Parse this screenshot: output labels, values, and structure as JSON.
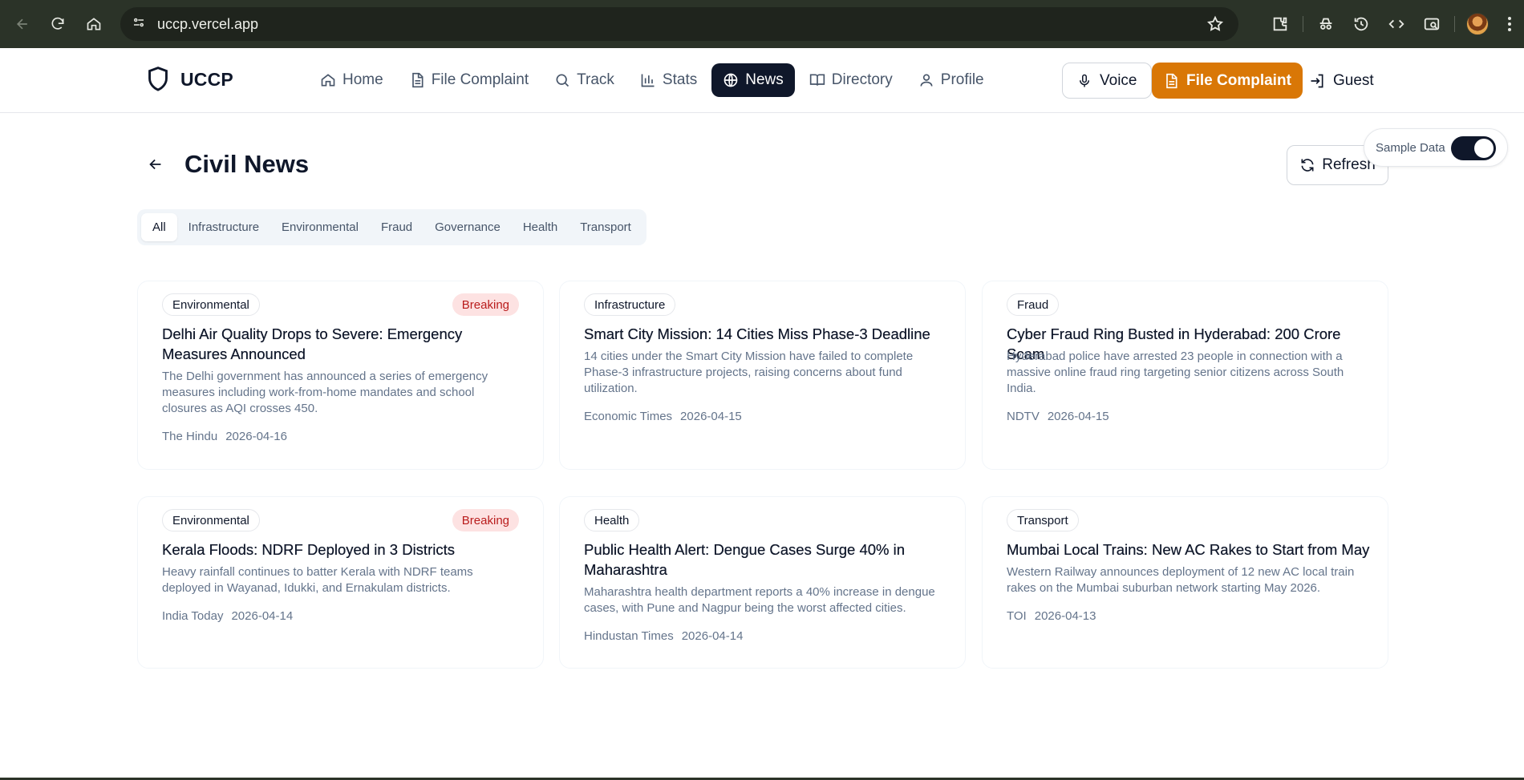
{
  "browser": {
    "url": "uccp.vercel.app"
  },
  "header": {
    "brand": "UCCP",
    "nav": [
      {
        "label": "Home",
        "icon": "home-icon"
      },
      {
        "label": "File Complaint",
        "icon": "file-icon"
      },
      {
        "label": "Track",
        "icon": "search-icon"
      },
      {
        "label": "Stats",
        "icon": "bar-chart-icon"
      },
      {
        "label": "News",
        "icon": "globe-icon"
      },
      {
        "label": "Directory",
        "icon": "book-icon"
      },
      {
        "label": "Profile",
        "icon": "user-icon"
      }
    ],
    "active_nav": "News",
    "voice_label": "Voice",
    "file_complaint_label": "File Complaint",
    "guest_label": "Guest"
  },
  "page": {
    "title": "Civil News",
    "refresh_label": "Refresh",
    "sample_data_label": "Sample Data",
    "sample_data_on": true
  },
  "filters": {
    "tabs": [
      "All",
      "Infrastructure",
      "Environmental",
      "Fraud",
      "Governance",
      "Health",
      "Transport"
    ],
    "active": "All"
  },
  "articles": [
    {
      "category": "Environmental",
      "breaking": "Breaking",
      "title": "Delhi Air Quality Drops to Severe: Emergency Measures Announced",
      "summary": "The Delhi government has announced a series of emergency measures including work-from-home mandates and school closures as AQI crosses 450.",
      "source": "The Hindu",
      "date": "2026-04-16"
    },
    {
      "category": "Infrastructure",
      "breaking": "",
      "title": "Smart City Mission: 14 Cities Miss Phase-3 Deadline",
      "summary": "14 cities under the Smart City Mission have failed to complete Phase-3 infrastructure projects, raising concerns about fund utilization.",
      "source": "Economic Times",
      "date": "2026-04-15"
    },
    {
      "category": "Fraud",
      "breaking": "",
      "title": "Cyber Fraud Ring Busted in Hyderabad: 200 Crore Scam",
      "summary": "Hyderabad police have arrested 23 people in connection with a massive online fraud ring targeting senior citizens across South India.",
      "source": "NDTV",
      "date": "2026-04-15"
    },
    {
      "category": "Environmental",
      "breaking": "Breaking",
      "title": "Kerala Floods: NDRF Deployed in 3 Districts",
      "summary": "Heavy rainfall continues to batter Kerala with NDRF teams deployed in Wayanad, Idukki, and Ernakulam districts.",
      "source": "India Today",
      "date": "2026-04-14"
    },
    {
      "category": "Health",
      "breaking": "",
      "title": "Public Health Alert: Dengue Cases Surge 40% in Maharashtra",
      "summary": "Maharashtra health department reports a 40% increase in dengue cases, with Pune and Nagpur being the worst affected cities.",
      "source": "Hindustan Times",
      "date": "2026-04-14"
    },
    {
      "category": "Transport",
      "breaking": "",
      "title": "Mumbai Local Trains: New AC Rakes to Start from May",
      "summary": "Western Railway announces deployment of 12 new AC local train rakes on the Mumbai suburban network starting May 2026.",
      "source": "TOI",
      "date": "2026-04-13"
    }
  ],
  "colors": {
    "primary": "#0f172a",
    "accent": "#d97706",
    "breaking_bg": "#fde2e2",
    "breaking_text": "#b91c1c",
    "chrome": "#2b3328"
  }
}
